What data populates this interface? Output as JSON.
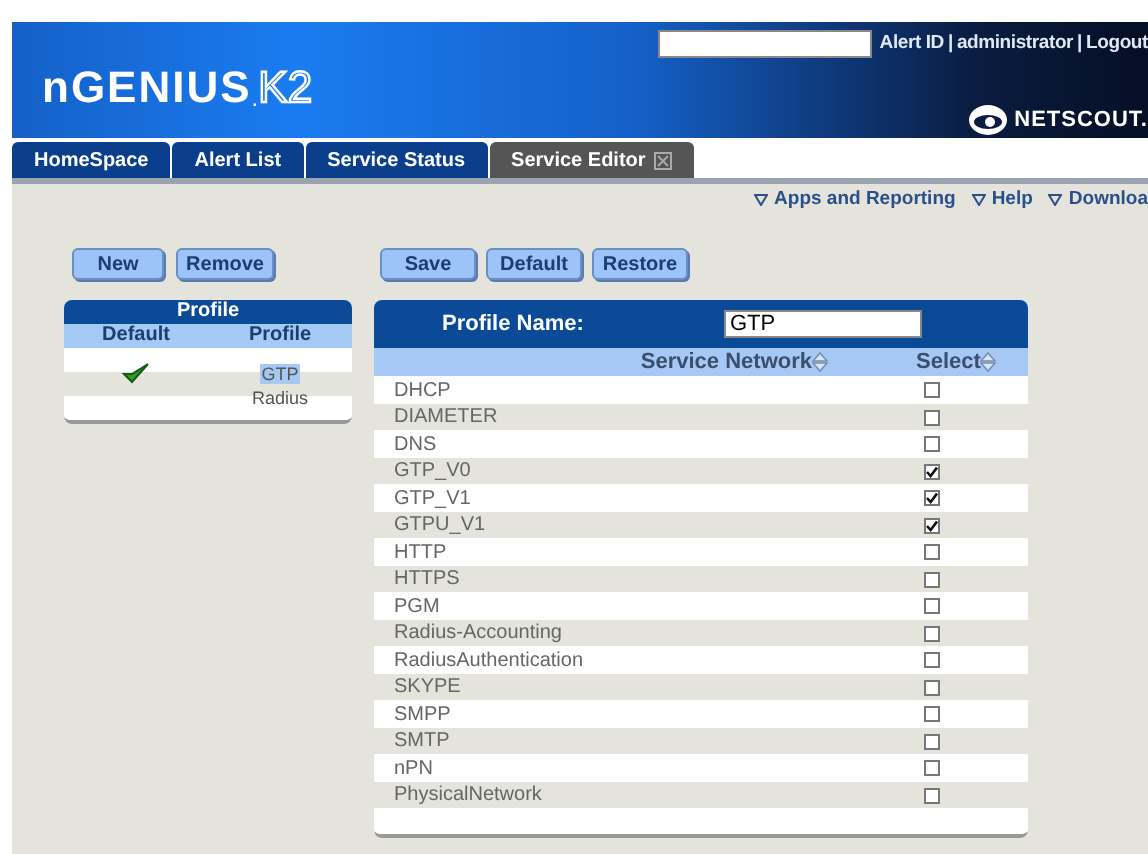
{
  "header": {
    "links": [
      "Alert ID",
      "administrator",
      "Logout"
    ],
    "separators": [
      "|",
      "|"
    ],
    "logo": {
      "main": "nGENIUS",
      "dot": ".",
      "suffix": "K2"
    },
    "brand": "NETSCOUT."
  },
  "tabs": [
    {
      "label": "HomeSpace",
      "selected": false,
      "closable": false
    },
    {
      "label": "Alert List",
      "selected": false,
      "closable": false
    },
    {
      "label": "Service Status",
      "selected": false,
      "closable": false
    },
    {
      "label": "Service Editor",
      "selected": true,
      "closable": true
    }
  ],
  "menu": [
    "Apps and Reporting",
    "Help",
    "Downloa"
  ],
  "profile_buttons": [
    "New",
    "Remove"
  ],
  "profile_panel": {
    "title": "Profile",
    "columns": [
      "Default",
      "Profile"
    ],
    "rows": [
      {
        "default": true,
        "name": "GTP",
        "selected": true
      },
      {
        "default": false,
        "name": "Radius",
        "selected": false
      }
    ]
  },
  "editor_buttons": [
    "Save",
    "Default",
    "Restore"
  ],
  "editor": {
    "name_label": "Profile Name:",
    "name_value": "GTP",
    "columns": [
      "Service Network",
      "Select"
    ],
    "rows": [
      {
        "name": "DHCP",
        "checked": false
      },
      {
        "name": "DIAMETER",
        "checked": false
      },
      {
        "name": "DNS",
        "checked": false
      },
      {
        "name": "GTP_V0",
        "checked": true
      },
      {
        "name": "GTP_V1",
        "checked": true
      },
      {
        "name": "GTPU_V1",
        "checked": true
      },
      {
        "name": "HTTP",
        "checked": false
      },
      {
        "name": "HTTPS",
        "checked": false
      },
      {
        "name": "PGM",
        "checked": false
      },
      {
        "name": "Radius-Accounting",
        "checked": false
      },
      {
        "name": "RadiusAuthentication",
        "checked": false
      },
      {
        "name": "SKYPE",
        "checked": false
      },
      {
        "name": "SMPP",
        "checked": false
      },
      {
        "name": "SMTP",
        "checked": false
      },
      {
        "name": "nPN",
        "checked": false
      },
      {
        "name": "PhysicalNetwork",
        "checked": false
      }
    ]
  }
}
